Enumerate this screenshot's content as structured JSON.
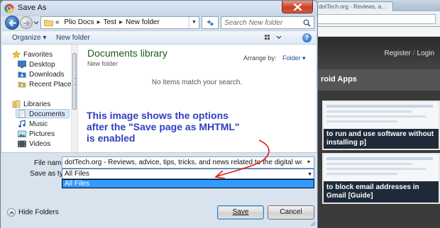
{
  "window": {
    "title": "Save As"
  },
  "navigation": {
    "breadcrumbs": [
      "«",
      "Plio Docs",
      "Test",
      "New folder"
    ],
    "search_placeholder": "Search New folder"
  },
  "toolbar": {
    "organize": "Organize ▾",
    "new_folder": "New folder"
  },
  "sidebar": {
    "favorites": "Favorites",
    "items": [
      {
        "label": "Desktop"
      },
      {
        "label": "Downloads"
      },
      {
        "label": "Recent Places"
      }
    ],
    "libraries": "Libraries",
    "library_items": [
      {
        "label": "Documents"
      },
      {
        "label": "Music"
      },
      {
        "label": "Pictures"
      },
      {
        "label": "Videos"
      }
    ]
  },
  "content": {
    "library_title": "Documents library",
    "library_subtitle": "New folder",
    "arrange_label": "Arrange by:",
    "arrange_value": "Folder ▾",
    "empty_message": "No items match your search.",
    "annotation": "This image shows the options after the \"Save page as MHTML\" is enabled"
  },
  "form": {
    "file_name_label": "File name:",
    "file_name_value": "dotTech.org - Reviews, advice, tips, tricks, and news related to the digital world!dotTech  Professi",
    "save_as_type_label": "Save as type:",
    "save_as_type_value": "All Files",
    "save_as_type_options": [
      "All Files"
    ]
  },
  "footer": {
    "hide_folders": "Hide Folders",
    "save": "Save",
    "cancel": "Cancel"
  },
  "background_page": {
    "tab_text": "dotTech.org - Reviews, a...",
    "login": [
      "Register",
      "Login"
    ],
    "section_title": "roid Apps",
    "card1_text": "to run and use software without installing p]",
    "card2_text": "to block email addresses in Gmail [Guide]"
  },
  "colors": {
    "annotation": "#2e3fbf",
    "selection": "#3399ff",
    "library_title": "#1f5a1f"
  }
}
